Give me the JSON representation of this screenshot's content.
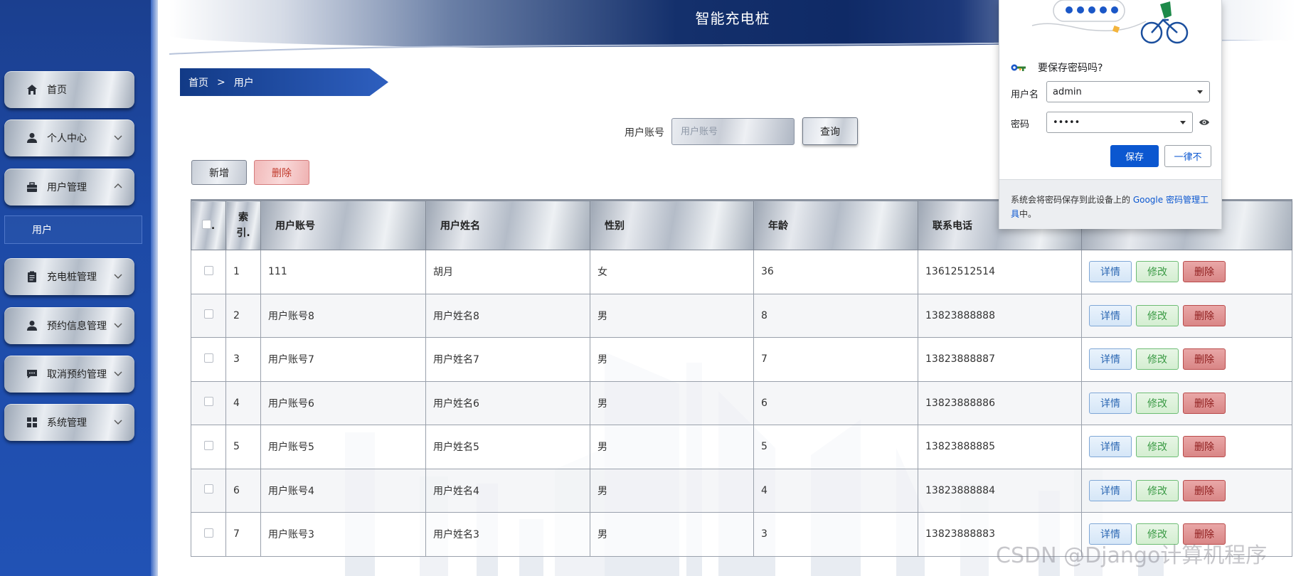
{
  "app": {
    "title": "智能充电桩"
  },
  "sidebar": {
    "items": [
      {
        "label": "首页",
        "icon": "home-icon",
        "expandable": false
      },
      {
        "label": "个人中心",
        "icon": "person-icon",
        "expandable": true,
        "expanded": false
      },
      {
        "label": "用户管理",
        "icon": "briefcase-icon",
        "expandable": true,
        "expanded": true
      },
      {
        "label": "充电桩管理",
        "icon": "clipboard-icon",
        "expandable": true,
        "expanded": false
      },
      {
        "label": "预约信息管理",
        "icon": "person-icon",
        "expandable": true,
        "expanded": false
      },
      {
        "label": "取消预约管理",
        "icon": "chat-icon",
        "expandable": true,
        "expanded": false
      },
      {
        "label": "系统管理",
        "icon": "grid-icon",
        "expandable": true,
        "expanded": false
      }
    ],
    "submenu_active": "用户"
  },
  "breadcrumb": {
    "home": "首页",
    "separator": ">",
    "current": "用户"
  },
  "search": {
    "label": "用户账号",
    "placeholder": "用户账号",
    "value": "",
    "button": "查询"
  },
  "actions": {
    "add": "新增",
    "delete": "删除"
  },
  "table": {
    "headers": {
      "select": ".",
      "index": "索引.",
      "account": "用户账号",
      "name": "用户姓名",
      "gender": "性别",
      "age": "年龄",
      "phone": "联系电话",
      "ops": ""
    },
    "row_actions": {
      "detail": "详情",
      "edit": "修改",
      "delete": "删除"
    },
    "rows": [
      {
        "index": "1",
        "account": "111",
        "name": "胡月",
        "gender": "女",
        "age": "36",
        "phone": "13612512514"
      },
      {
        "index": "2",
        "account": "用户账号8",
        "name": "用户姓名8",
        "gender": "男",
        "age": "8",
        "phone": "13823888888"
      },
      {
        "index": "3",
        "account": "用户账号7",
        "name": "用户姓名7",
        "gender": "男",
        "age": "7",
        "phone": "13823888887"
      },
      {
        "index": "4",
        "account": "用户账号6",
        "name": "用户姓名6",
        "gender": "男",
        "age": "6",
        "phone": "13823888886"
      },
      {
        "index": "5",
        "account": "用户账号5",
        "name": "用户姓名5",
        "gender": "男",
        "age": "5",
        "phone": "13823888885"
      },
      {
        "index": "6",
        "account": "用户账号4",
        "name": "用户姓名4",
        "gender": "男",
        "age": "4",
        "phone": "13823888884"
      },
      {
        "index": "7",
        "account": "用户账号3",
        "name": "用户姓名3",
        "gender": "男",
        "age": "3",
        "phone": "13823888883"
      }
    ]
  },
  "password_popup": {
    "title": "要保存密码吗?",
    "username_label": "用户名",
    "username_value": "admin",
    "password_label": "密码",
    "password_value": "•••••",
    "save_button": "保存",
    "never_button": "一律不",
    "footer_text_before": "系统会将密码保存到此设备上的 ",
    "footer_link": "Google 密码管理工具",
    "footer_text_after": "中。",
    "accent_color": "#0b57d0"
  },
  "watermark": "CSDN @Django计算机程序"
}
